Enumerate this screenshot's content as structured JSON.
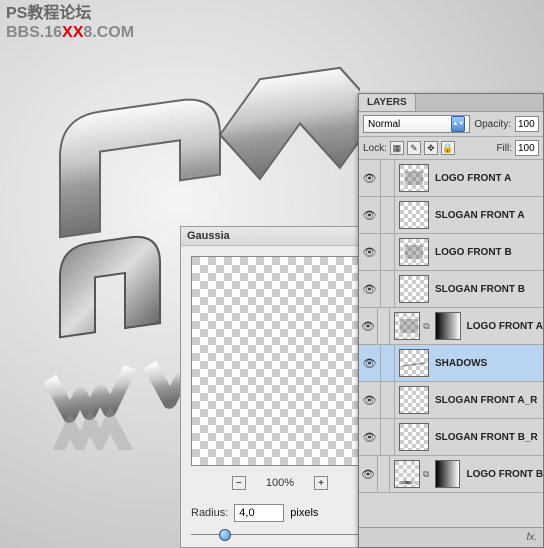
{
  "watermark": {
    "line1": "PS教程论坛",
    "line2_a": "BBS.16",
    "line2_b": "XX",
    "line2_c": "8.COM"
  },
  "gaussian": {
    "title": "Gaussia",
    "zoom_minus": "−",
    "zoom_plus": "+",
    "zoom_level": "100%",
    "radius_label": "Radius:",
    "radius_value": "4,0",
    "radius_unit": "pixels"
  },
  "layers_panel": {
    "tab": "LAYERS",
    "blend_mode": "Normal",
    "opacity_label": "Opacity:",
    "opacity_value": "100",
    "lock_label": "Lock:",
    "fill_label": "Fill:",
    "fill_value": "100",
    "footer_fx": "fx."
  },
  "layers": [
    {
      "name": "LOGO FRONT A",
      "thumb": "with-content",
      "mask": null,
      "indented": false,
      "selected": false
    },
    {
      "name": "SLOGAN FRONT A",
      "thumb": "checker",
      "mask": null,
      "indented": false,
      "selected": false
    },
    {
      "name": "LOGO FRONT B",
      "thumb": "with-content",
      "mask": null,
      "indented": false,
      "selected": false
    },
    {
      "name": "SLOGAN FRONT B",
      "thumb": "checker",
      "mask": null,
      "indented": false,
      "selected": false
    },
    {
      "name": "LOGO FRONT A_R",
      "thumb": "with-content",
      "mask": "gradient",
      "indented": true,
      "selected": false
    },
    {
      "name": "SHADOWS",
      "thumb": "line-t",
      "mask": null,
      "indented": false,
      "selected": true
    },
    {
      "name": "SLOGAN FRONT A_R",
      "thumb": "checker",
      "mask": null,
      "indented": false,
      "selected": false
    },
    {
      "name": "SLOGAN FRONT B_R",
      "thumb": "checker",
      "mask": null,
      "indented": false,
      "selected": false
    },
    {
      "name": "LOGO FRONT B_R",
      "thumb": "shadow-t",
      "mask": "gradient",
      "indented": true,
      "selected": false
    }
  ],
  "icons": {
    "eye": "👁"
  }
}
